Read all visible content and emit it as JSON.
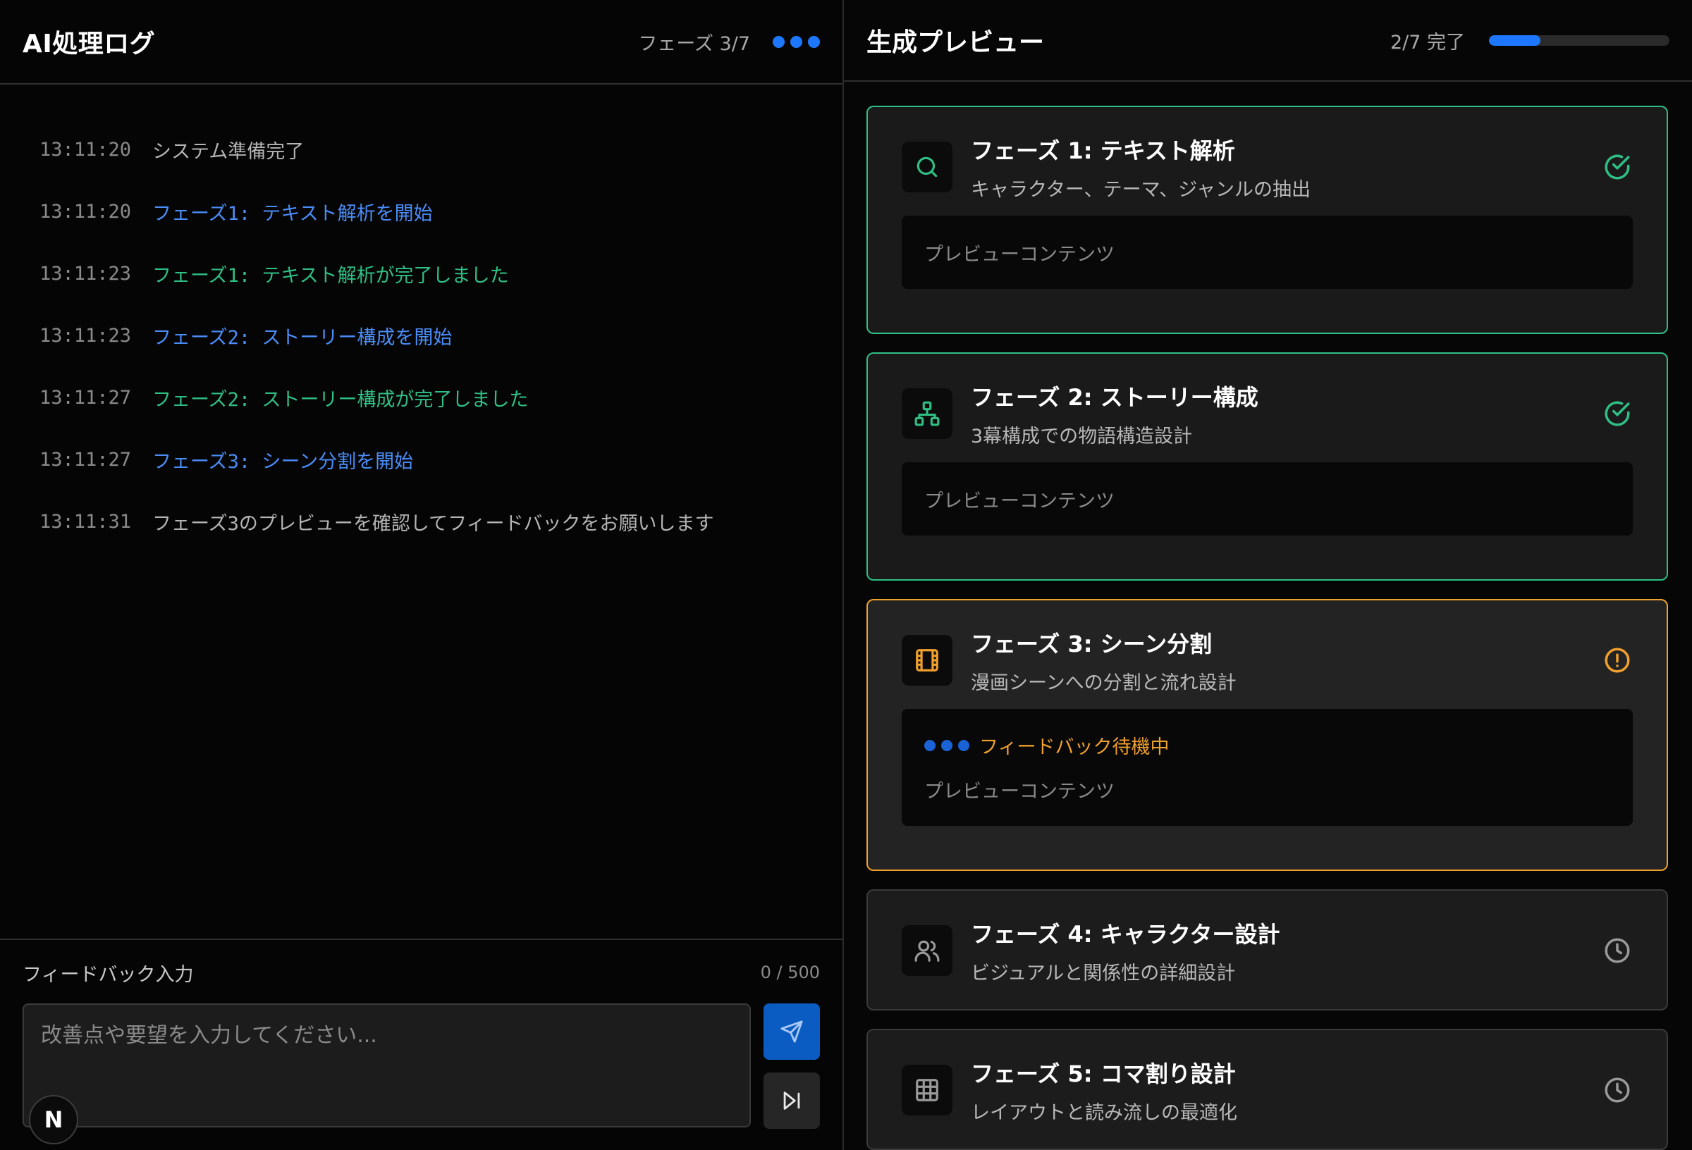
{
  "left": {
    "title": "AI処理ログ",
    "phase_label": "フェーズ 3/7",
    "logs": [
      {
        "time": "13:11:20",
        "message": "システム準備完了",
        "kind": "system"
      },
      {
        "time": "13:11:20",
        "message": "フェーズ1: テキスト解析を開始",
        "kind": "start"
      },
      {
        "time": "13:11:23",
        "message": "フェーズ1: テキスト解析が完了しました",
        "kind": "complete"
      },
      {
        "time": "13:11:23",
        "message": "フェーズ2: ストーリー構成を開始",
        "kind": "start"
      },
      {
        "time": "13:11:27",
        "message": "フェーズ2: ストーリー構成が完了しました",
        "kind": "complete"
      },
      {
        "time": "13:11:27",
        "message": "フェーズ3: シーン分割を開始",
        "kind": "start"
      },
      {
        "time": "13:11:31",
        "message": "フェーズ3のプレビューを確認してフィードバックをお願いします",
        "kind": "system"
      }
    ],
    "feedback": {
      "label": "フィードバック入力",
      "counter": "0 / 500",
      "placeholder": "改善点や要望を入力してください...",
      "value": ""
    },
    "badge_letter": "N"
  },
  "right": {
    "title": "生成プレビュー",
    "progress_label": "2/7 完了",
    "progress_fraction": 0.2857,
    "cards": [
      {
        "title": "フェーズ 1: テキスト解析",
        "desc": "キャラクター、テーマ、ジャンルの抽出",
        "status": "done",
        "icon": "search-icon",
        "preview": "プレビューコンテンツ"
      },
      {
        "title": "フェーズ 2: ストーリー構成",
        "desc": "3幕構成での物語構造設計",
        "status": "done",
        "icon": "sitemap-icon",
        "preview": "プレビューコンテンツ"
      },
      {
        "title": "フェーズ 3: シーン分割",
        "desc": "漫画シーンへの分割と流れ設計",
        "status": "waiting",
        "icon": "film-icon",
        "preview": "プレビューコンテンツ",
        "waiting_text": "フィードバック待機中"
      },
      {
        "title": "フェーズ 4: キャラクター設計",
        "desc": "ビジュアルと関係性の詳細設計",
        "status": "pending",
        "icon": "users-icon"
      },
      {
        "title": "フェーズ 5: コマ割り設計",
        "desc": "レイアウトと読み流しの最適化",
        "status": "pending",
        "icon": "grid-icon"
      }
    ]
  },
  "colors": {
    "accent": "#1e78ff",
    "done": "#2fbf85",
    "waiting": "#f0a02c",
    "pending": "#9a9a9a"
  }
}
